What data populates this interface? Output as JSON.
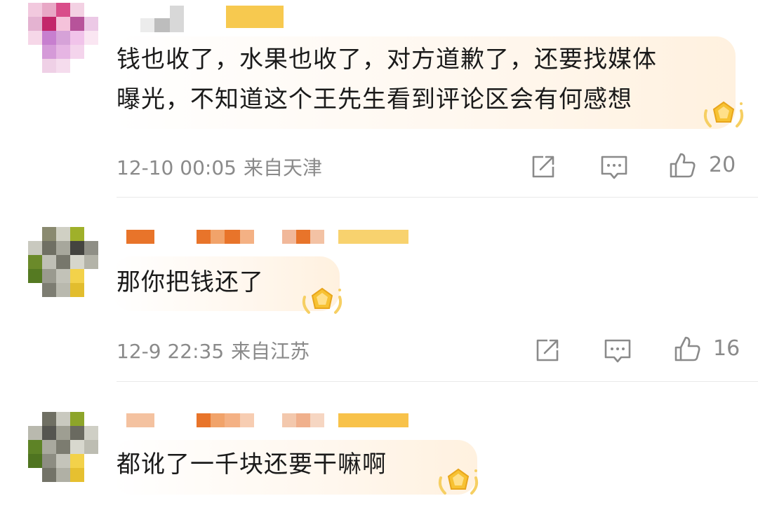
{
  "comments": [
    {
      "text_line1": "钱也收了，水果也收了，对方道歉了，还要找媒体",
      "text_line2": "曝光，不知道这个王先生看到评论区会有何感想",
      "date": "12-10 00:05",
      "location": "来自天津",
      "likes": "20"
    },
    {
      "text_line1": "那你把钱还了",
      "date": "12-9 22:35",
      "location": "来自江苏",
      "likes": "16"
    },
    {
      "text_line1": "都讹了一千块还要干嘛啊"
    }
  ],
  "icons": {
    "share": "share-icon",
    "reply": "comment-icon",
    "like": "thumbs-up-icon",
    "badge": "gold-badge-icon"
  },
  "colors": {
    "text": "#1a1a1a",
    "meta": "#8a8a8a",
    "bubble": "#fff3e3",
    "badge": "#f7c233"
  }
}
